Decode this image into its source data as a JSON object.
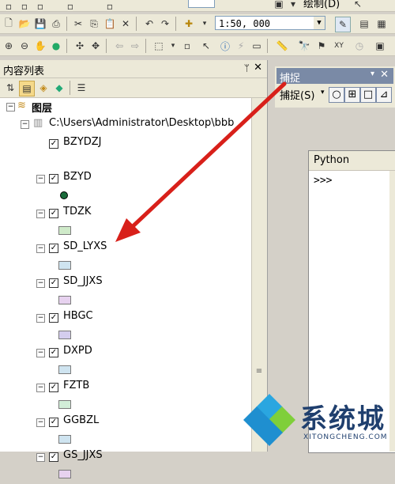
{
  "toolbar": {
    "draw_menu": "绘制(D)",
    "scale": "1:50, 000"
  },
  "toc": {
    "title": "内容列表",
    "root": "图层",
    "path": "C:\\Users\\Administrator\\Desktop\\bbb",
    "layers": [
      {
        "name": "BZYDZJ",
        "symbol": "none",
        "color": ""
      },
      {
        "name": "BZYD",
        "symbol": "point",
        "color": "#1a6b3a"
      },
      {
        "name": "TDZK",
        "symbol": "fill",
        "color": "#cfeac9"
      },
      {
        "name": "SD_LYXS",
        "symbol": "fill",
        "color": "#cfe4f0"
      },
      {
        "name": "SD_JJXS",
        "symbol": "fill",
        "color": "#e7d2ef"
      },
      {
        "name": "HBGC",
        "symbol": "fill",
        "color": "#d4cdee"
      },
      {
        "name": "DXPD",
        "symbol": "fill",
        "color": "#cfe4f0"
      },
      {
        "name": "FZTB",
        "symbol": "fill",
        "color": "#d2eed8"
      },
      {
        "name": "GGBZL",
        "symbol": "fill",
        "color": "#cfe4f0"
      },
      {
        "name": "GS_JJXS",
        "symbol": "fill",
        "color": "#e7d2ef"
      }
    ]
  },
  "snapping": {
    "title": "捕捉",
    "menu": "捕捉(S)"
  },
  "python": {
    "title": "Python",
    "prompt": ">>>"
  },
  "watermark": {
    "name": "系统城",
    "url": "XITONGCHENG.COM"
  },
  "annotation": {
    "color": "#d8201a"
  }
}
